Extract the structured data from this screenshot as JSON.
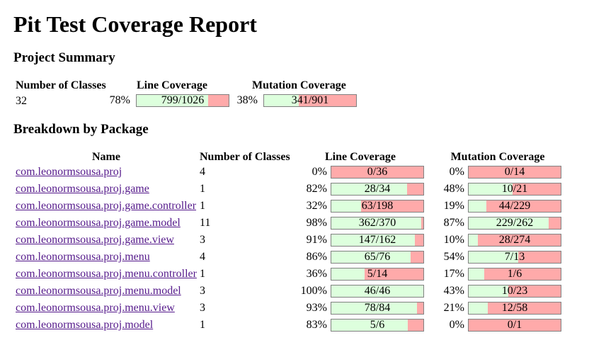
{
  "title": "Pit Test Coverage Report",
  "summary": {
    "heading": "Project Summary",
    "headers": {
      "classes": "Number of Classes",
      "line": "Line Coverage",
      "mutation": "Mutation Coverage"
    },
    "classes": "32",
    "line": {
      "pct": "78%",
      "label": "799/1026",
      "fraction": 0.78
    },
    "mutation": {
      "pct": "38%",
      "label": "341/901",
      "fraction": 0.38
    }
  },
  "breakdown": {
    "heading": "Breakdown by Package",
    "headers": {
      "name": "Name",
      "classes": "Number of Classes",
      "line": "Line Coverage",
      "mutation": "Mutation Coverage"
    },
    "rows": [
      {
        "name": "com.leonormsousa.proj",
        "classes": "4",
        "line": {
          "pct": "0%",
          "label": "0/36",
          "fraction": 0.0
        },
        "mutation": {
          "pct": "0%",
          "label": "0/14",
          "fraction": 0.0
        }
      },
      {
        "name": "com.leonormsousa.proj.game",
        "classes": "1",
        "line": {
          "pct": "82%",
          "label": "28/34",
          "fraction": 0.82
        },
        "mutation": {
          "pct": "48%",
          "label": "10/21",
          "fraction": 0.48
        }
      },
      {
        "name": "com.leonormsousa.proj.game.controller",
        "classes": "1",
        "line": {
          "pct": "32%",
          "label": "63/198",
          "fraction": 0.32
        },
        "mutation": {
          "pct": "19%",
          "label": "44/229",
          "fraction": 0.19
        }
      },
      {
        "name": "com.leonormsousa.proj.game.model",
        "classes": "11",
        "line": {
          "pct": "98%",
          "label": "362/370",
          "fraction": 0.98
        },
        "mutation": {
          "pct": "87%",
          "label": "229/262",
          "fraction": 0.87
        }
      },
      {
        "name": "com.leonormsousa.proj.game.view",
        "classes": "3",
        "line": {
          "pct": "91%",
          "label": "147/162",
          "fraction": 0.91
        },
        "mutation": {
          "pct": "10%",
          "label": "28/274",
          "fraction": 0.1
        }
      },
      {
        "name": "com.leonormsousa.proj.menu",
        "classes": "4",
        "line": {
          "pct": "86%",
          "label": "65/76",
          "fraction": 0.86
        },
        "mutation": {
          "pct": "54%",
          "label": "7/13",
          "fraction": 0.54
        }
      },
      {
        "name": "com.leonormsousa.proj.menu.controller",
        "classes": "1",
        "line": {
          "pct": "36%",
          "label": "5/14",
          "fraction": 0.36
        },
        "mutation": {
          "pct": "17%",
          "label": "1/6",
          "fraction": 0.17
        }
      },
      {
        "name": "com.leonormsousa.proj.menu.model",
        "classes": "3",
        "line": {
          "pct": "100%",
          "label": "46/46",
          "fraction": 1.0
        },
        "mutation": {
          "pct": "43%",
          "label": "10/23",
          "fraction": 0.43
        }
      },
      {
        "name": "com.leonormsousa.proj.menu.view",
        "classes": "3",
        "line": {
          "pct": "93%",
          "label": "78/84",
          "fraction": 0.93
        },
        "mutation": {
          "pct": "21%",
          "label": "12/58",
          "fraction": 0.21
        }
      },
      {
        "name": "com.leonormsousa.proj.model",
        "classes": "1",
        "line": {
          "pct": "83%",
          "label": "5/6",
          "fraction": 0.83
        },
        "mutation": {
          "pct": "0%",
          "label": "0/1",
          "fraction": 0.0
        }
      }
    ]
  },
  "colors": {
    "covered": "#ddffdd",
    "uncovered": "#ffaaaa",
    "link": "#551a8b",
    "bar_border": "#808080"
  }
}
